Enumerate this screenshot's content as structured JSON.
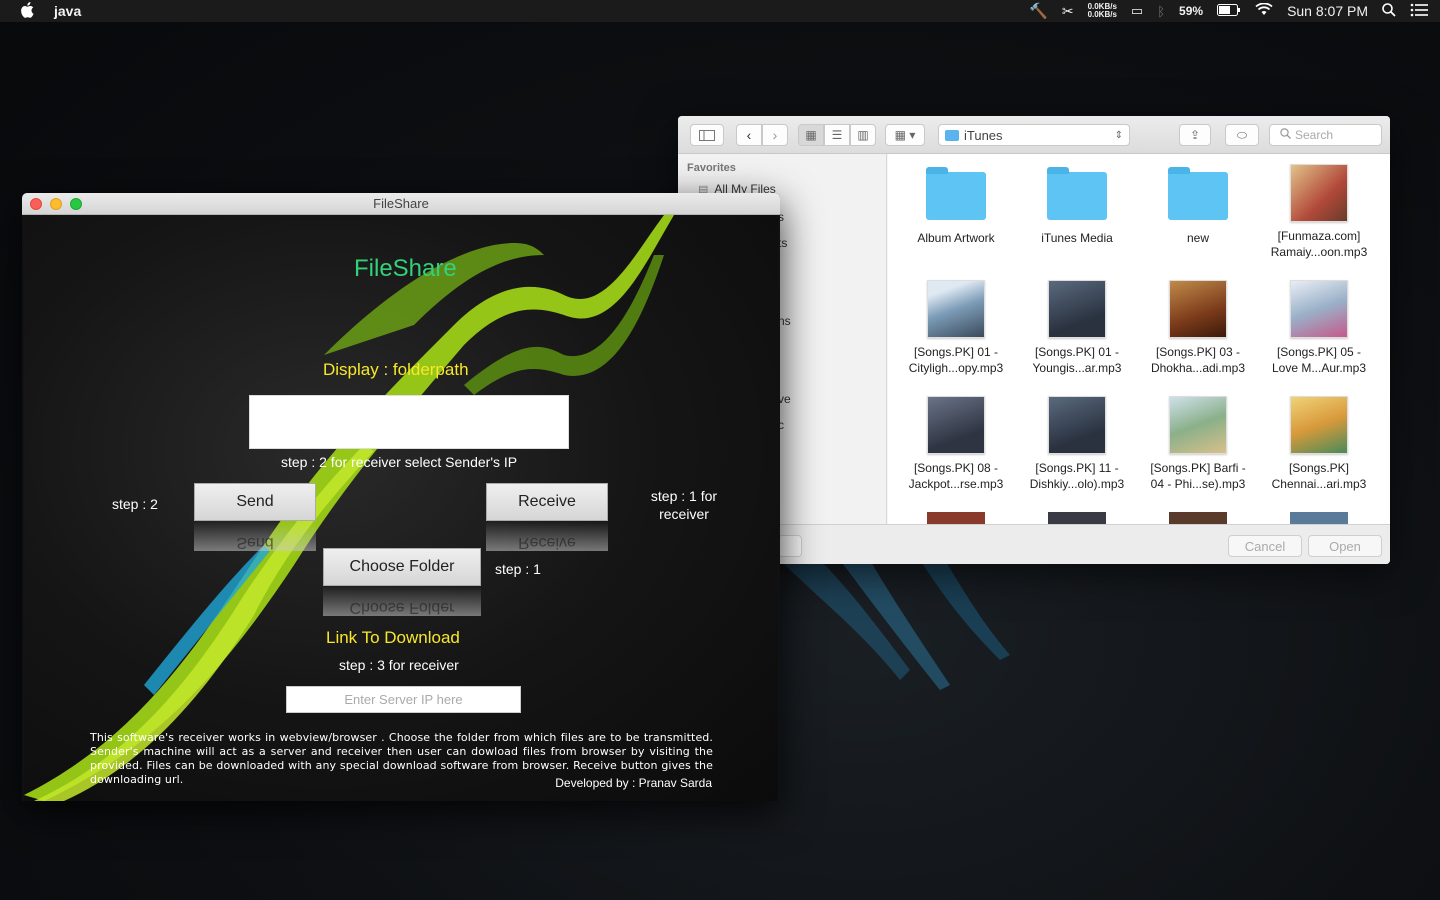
{
  "menubar": {
    "app_name": "java",
    "net_up": "0.0KB/s",
    "net_down": "0.0KB/s",
    "battery": "59%",
    "clock": "Sun 8:07 PM"
  },
  "finder": {
    "path": "iTunes",
    "search_placeholder": "Search",
    "sidebar_section": "Favorites",
    "sidebar_item": "All My Files",
    "sidebar_fragments": [
      "s",
      "ts",
      "ns",
      "ve",
      "c"
    ],
    "items": [
      {
        "label1": "Album Artwork",
        "label2": "",
        "kind": "folder"
      },
      {
        "label1": "iTunes Media",
        "label2": "",
        "kind": "folder"
      },
      {
        "label1": "new",
        "label2": "",
        "kind": "folder"
      },
      {
        "label1": "[Funmaza.com]",
        "label2": "Ramaiy...oon.mp3",
        "kind": "album",
        "color": "#c9a46a"
      },
      {
        "label1": "[Songs.PK] 01 -",
        "label2": "Cityligh...opy.mp3",
        "kind": "album",
        "color": "#8fb0c9"
      },
      {
        "label1": "[Songs.PK] 01 -",
        "label2": "Youngis...ar.mp3",
        "kind": "album",
        "color": "#3d4a5a"
      },
      {
        "label1": "[Songs.PK] 03 -",
        "label2": "Dhokha...adi.mp3",
        "kind": "album",
        "color": "#9b5a2e"
      },
      {
        "label1": "[Songs.PK] 05 -",
        "label2": "Love M...Aur.mp3",
        "kind": "album",
        "color": "#b9c6d8"
      },
      {
        "label1": "[Songs.PK] 08 -",
        "label2": "Jackpot...rse.mp3",
        "kind": "album",
        "color": "#4c5566"
      },
      {
        "label1": "[Songs.PK] 11 -",
        "label2": "Dishkiy...olo).mp3",
        "kind": "album",
        "color": "#3d4a5a"
      },
      {
        "label1": "[Songs.PK] Barfi -",
        "label2": "04 - Phi...se).mp3",
        "kind": "album",
        "color": "#a8c2a0"
      },
      {
        "label1": "[Songs.PK]",
        "label2": "Chennai...ari.mp3",
        "kind": "album",
        "color": "#d8b35a"
      }
    ],
    "cancel_label": "Cancel",
    "open_label": "Open"
  },
  "fileshare": {
    "window_title": "FileShare",
    "heading": "FileShare",
    "display_label": "Display : folderpath",
    "step2_receiver_label": "step : 2 for receiver select Sender's IP",
    "step2_label": "step : 2",
    "send_label": "Send",
    "receive_label": "Receive",
    "step1_receiver_line1": "step : 1 for",
    "step1_receiver_line2": "receiver",
    "choose_folder_label": "Choose Folder",
    "step1_label": "step : 1",
    "link_label": "Link To Download",
    "step3_label": "step : 3 for receiver",
    "ip_placeholder": "Enter Server IP here",
    "description": "This software's receiver works in webview/browser . Choose the folder from which files are to be transmitted. Sender's machine will act as a server and receiver then user can dowload files from browser by visiting the provided. Files can be downloaded with any special download software from browser. Receive button gives the downloading url.",
    "developer": "Developed by : Pranav Sarda"
  },
  "colors": {
    "heading_green": "#33d17a",
    "label_yellow": "#f7e82a",
    "swoosh_green": "#a8d81a"
  }
}
